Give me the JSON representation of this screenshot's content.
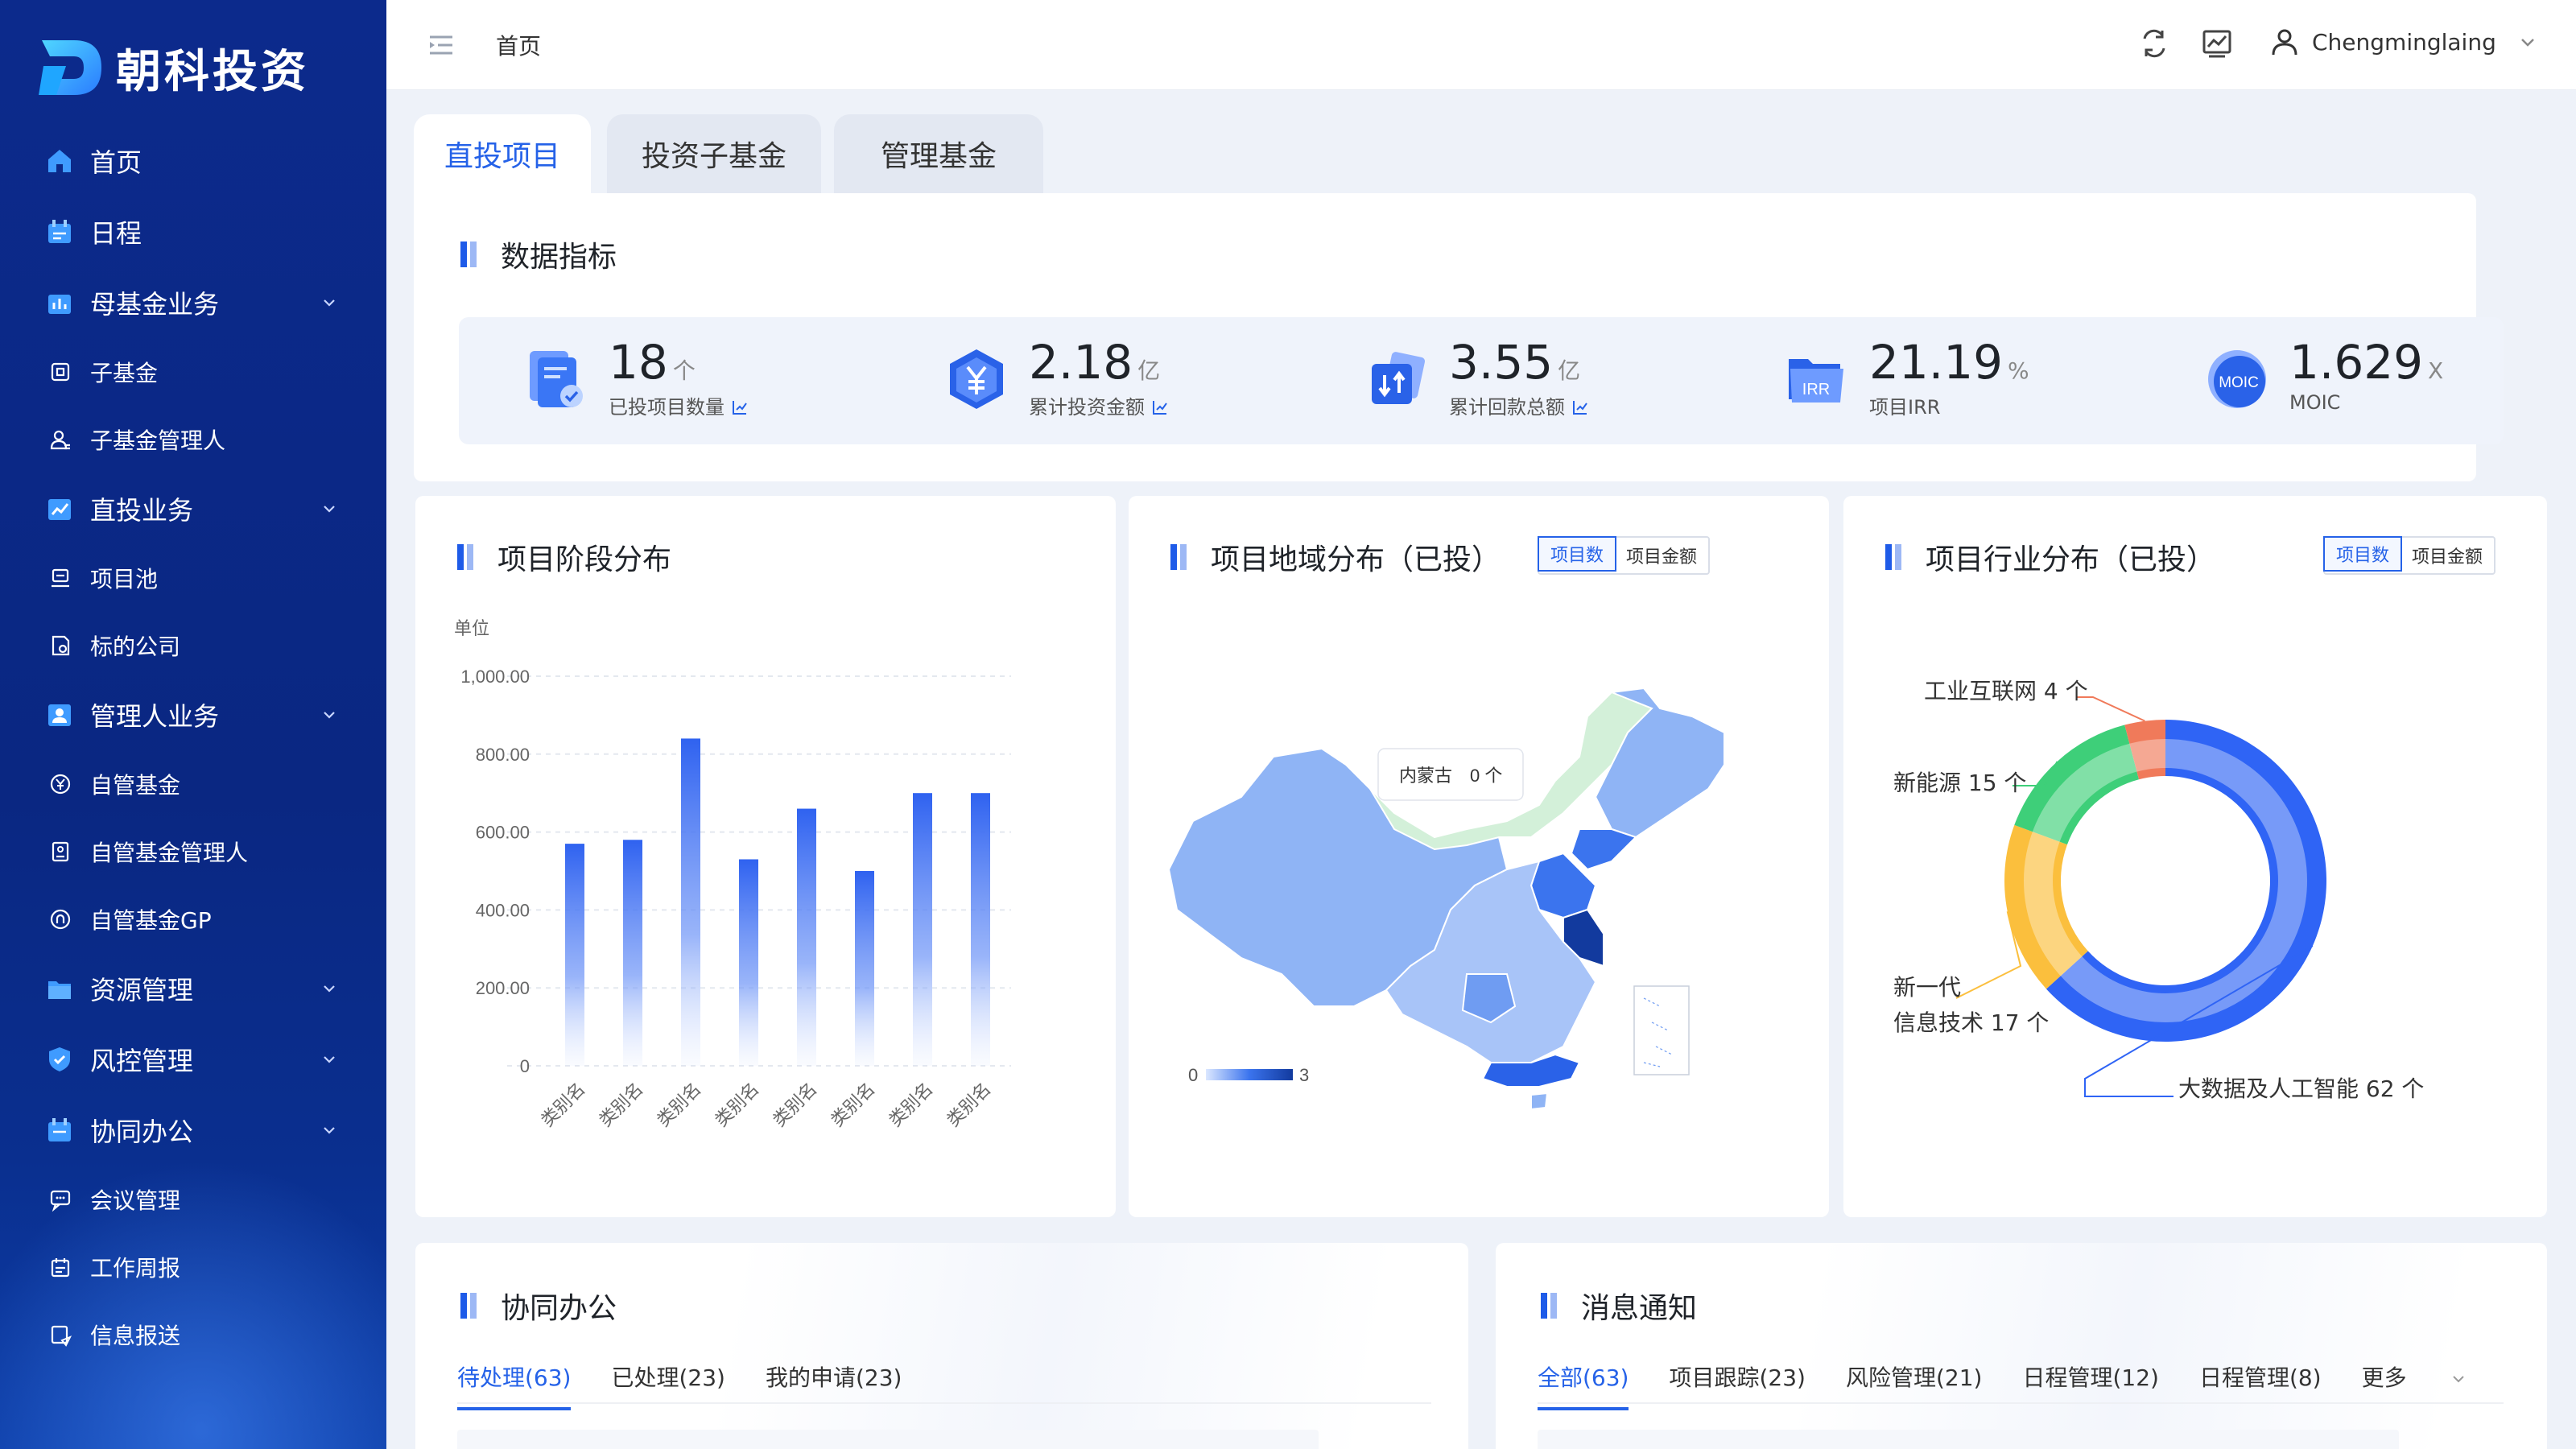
{
  "app": {
    "title": "朝科投资"
  },
  "sidebar": {
    "items": [
      {
        "label": "首页",
        "icon": "home-icon"
      },
      {
        "label": "日程",
        "icon": "calendar-icon"
      },
      {
        "label": "母基金业务",
        "icon": "bar-chart-icon"
      },
      {
        "label": "子基金",
        "icon": "fund-icon"
      },
      {
        "label": "子基金管理人",
        "icon": "manager-icon"
      },
      {
        "label": "直投业务",
        "icon": "trend-icon"
      },
      {
        "label": "项目池",
        "icon": "pool-icon"
      },
      {
        "label": "标的公司",
        "icon": "company-icon"
      },
      {
        "label": "管理人业务",
        "icon": "user-card-icon"
      },
      {
        "label": "自管基金",
        "icon": "yen-circle-icon"
      },
      {
        "label": "自管基金管理人",
        "icon": "badge-icon"
      },
      {
        "label": "自管基金GP",
        "icon": "gp-icon"
      },
      {
        "label": "资源管理",
        "icon": "folder-icon"
      },
      {
        "label": "风控管理",
        "icon": "shield-icon"
      },
      {
        "label": "协同办公",
        "icon": "office-icon"
      },
      {
        "label": "会议管理",
        "icon": "meeting-icon"
      },
      {
        "label": "工作周报",
        "icon": "report-icon"
      },
      {
        "label": "信息报送",
        "icon": "send-icon"
      }
    ]
  },
  "header": {
    "breadcrumb": "首页",
    "user": "Chengminglaing"
  },
  "tabs": [
    "直投项目",
    "投资子基金",
    "管理基金"
  ],
  "metrics": {
    "title": "数据指标",
    "items": [
      {
        "value": "18",
        "unit": "个",
        "label": "已投项目数量"
      },
      {
        "value": "2.18",
        "unit": "亿",
        "label": "累计投资金额"
      },
      {
        "value": "3.55",
        "unit": "亿",
        "label": "累计回款总额"
      },
      {
        "value": "21.19",
        "unit": "%",
        "label": "项目IRR",
        "icon_text": "IRR"
      },
      {
        "value": "1.629",
        "unit": "X",
        "label": "MOIC",
        "icon_text": "MOIC"
      }
    ]
  },
  "stage": {
    "title": "项目阶段分布"
  },
  "region": {
    "title": "项目地域分布（已投）",
    "toggle": [
      "项目数",
      "项目金额"
    ],
    "tooltip": "内蒙古",
    "tooltip_value": "0 个",
    "legend_min": "0",
    "legend_max": "3"
  },
  "industry": {
    "title": "项目行业分布（已投）",
    "toggle": [
      "项目数",
      "项目金额"
    ]
  },
  "office": {
    "title": "协同办公",
    "tabs": [
      "待处理(63)",
      "已处理(23)",
      "我的申请(23)"
    ]
  },
  "notice": {
    "title": "消息通知",
    "tabs": [
      "全部(63)",
      "项目跟踪(23)",
      "风险管理(21)",
      "日程管理(12)",
      "日程管理(8)",
      "更多"
    ]
  },
  "chart_data": [
    {
      "type": "bar",
      "title": "项目阶段分布",
      "ylabel": "单位",
      "ylim": [
        0,
        1000
      ],
      "yticks": [
        "0",
        "200.00",
        "400.00",
        "600.00",
        "800.00",
        "1,000.00"
      ],
      "categories": [
        "类别名",
        "类别名",
        "类别名",
        "类别名",
        "类别名",
        "类别名",
        "类别名",
        "类别名"
      ],
      "values": [
        570,
        580,
        840,
        530,
        660,
        500,
        700,
        700
      ],
      "grid": true
    },
    {
      "type": "pie",
      "title": "项目行业分布（已投）",
      "labels": [
        "大数据及人工智能",
        "新一代信息技术",
        "新能源",
        "工业互联网"
      ],
      "values": [
        62,
        17,
        15,
        4
      ],
      "unit": "个",
      "colors": [
        "#2f64f5",
        "#fbbf3d",
        "#3ecf79",
        "#f07a5a"
      ]
    }
  ]
}
